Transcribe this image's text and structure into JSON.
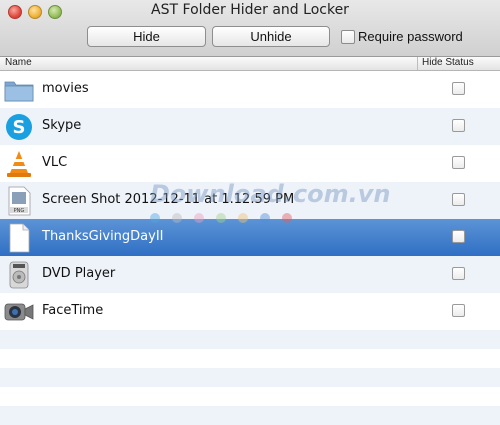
{
  "window": {
    "title": "AST Folder Hider and Locker"
  },
  "toolbar": {
    "hide_label": "Hide",
    "unhide_label": "Unhide",
    "require_password_label": "Require password",
    "require_password_checked": false
  },
  "table": {
    "columns": {
      "name": "Name",
      "status": "Hide Status"
    },
    "rows": [
      {
        "label": "movies",
        "icon": "folder-icon",
        "checked": false
      },
      {
        "label": "Skype",
        "icon": "skype-icon",
        "checked": false
      },
      {
        "label": "VLC",
        "icon": "vlc-icon",
        "checked": false
      },
      {
        "label": "Screen Shot 2012-12-11 at 1.12.59 PM",
        "icon": "png-file-icon",
        "checked": false
      },
      {
        "label": "ThanksGivingDayII",
        "icon": "document-icon",
        "checked": false,
        "selected": true
      },
      {
        "label": "DVD Player",
        "icon": "dvd-player-icon",
        "checked": false
      },
      {
        "label": "FaceTime",
        "icon": "facetime-icon",
        "checked": false
      }
    ]
  },
  "watermark": {
    "text": "Download.com.vn"
  },
  "colors": {
    "selection": "#3a78c8",
    "alt_row": "#eef3fa"
  }
}
